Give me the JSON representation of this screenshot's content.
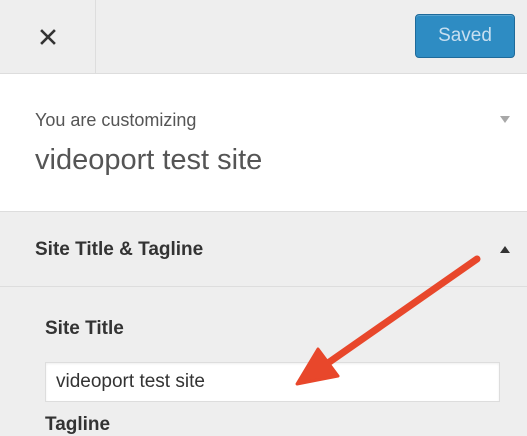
{
  "header": {
    "close_icon": "close-icon",
    "saved_label": "Saved"
  },
  "info": {
    "label": "You are customizing",
    "site_name": "videoport test site",
    "toggle_icon": "chevron-down-icon"
  },
  "section": {
    "title": "Site Title & Tagline",
    "toggle_icon": "triangle-up-icon"
  },
  "fields": {
    "site_title": {
      "label": "Site Title",
      "value": "videoport test site"
    },
    "tagline": {
      "label": "Tagline"
    }
  },
  "annotation": {
    "arrow_icon": "red-arrow-icon",
    "arrow_color": "#e8472b"
  },
  "colors": {
    "accent": "#2e8cc3",
    "panel_bg": "#eeeeee",
    "info_bg": "#ffffff",
    "text": "#555555"
  }
}
